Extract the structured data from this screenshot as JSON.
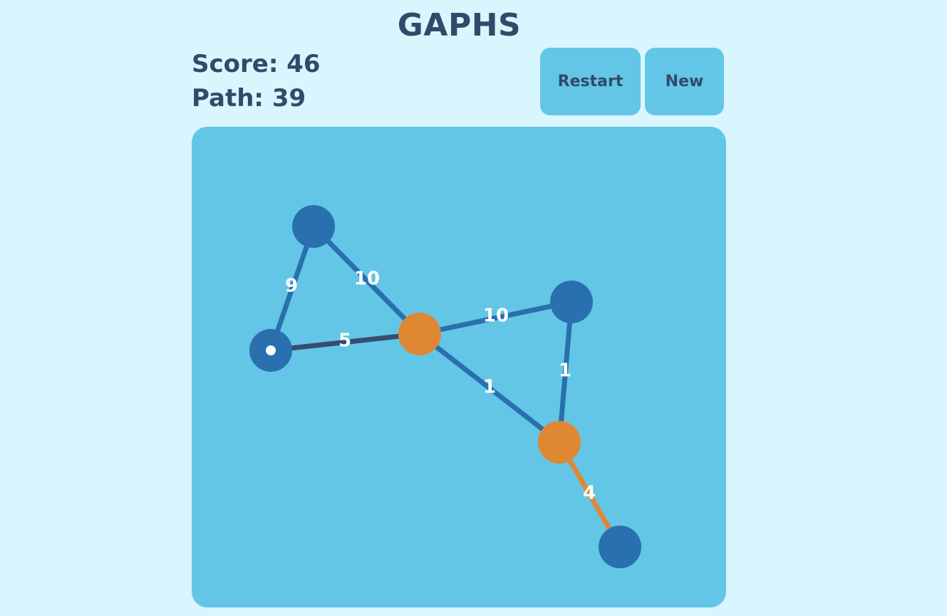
{
  "header": {
    "title": "GAPHS"
  },
  "stats": {
    "score_text": "Score: 46",
    "path_text": "Path: 39"
  },
  "buttons": {
    "restart_label": "Restart",
    "new_label": "New"
  },
  "colors": {
    "background": "#d9f6fe",
    "panel": "#63c6e6",
    "text": "#34496a",
    "node_default": "#2970ae",
    "node_visited": "#de8833",
    "edge_default": "#2970ae",
    "edge_traversed": "#384c70",
    "edge_highlight": "#de8833",
    "label": "#ffffff"
  },
  "graph": {
    "nodes": [
      {
        "id": "n1",
        "state": "default"
      },
      {
        "id": "n2",
        "state": "current"
      },
      {
        "id": "n3",
        "state": "visited"
      },
      {
        "id": "n4",
        "state": "default"
      },
      {
        "id": "n5",
        "state": "visited"
      },
      {
        "id": "n6",
        "state": "default"
      }
    ],
    "edges": [
      {
        "from": "n1",
        "to": "n2",
        "weight": "9",
        "state": "default"
      },
      {
        "from": "n1",
        "to": "n3",
        "weight": "10",
        "state": "default"
      },
      {
        "from": "n2",
        "to": "n3",
        "weight": "5",
        "state": "traversed"
      },
      {
        "from": "n3",
        "to": "n4",
        "weight": "10",
        "state": "default"
      },
      {
        "from": "n3",
        "to": "n5",
        "weight": "1",
        "state": "default"
      },
      {
        "from": "n4",
        "to": "n5",
        "weight": "1",
        "state": "default"
      },
      {
        "from": "n5",
        "to": "n6",
        "weight": "4",
        "state": "highlight"
      }
    ]
  }
}
